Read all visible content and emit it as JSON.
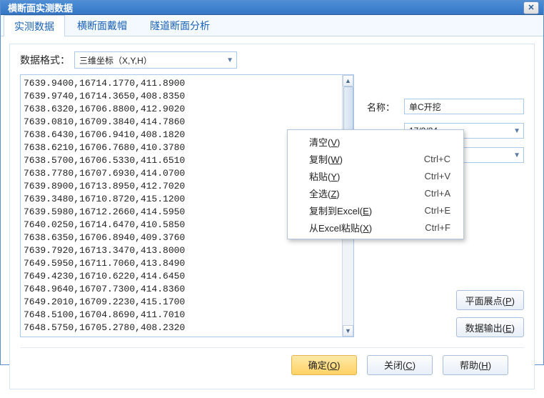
{
  "title": "横断面实测数据",
  "tabs": [
    {
      "label": "实测数据",
      "active": true
    },
    {
      "label": "横断面戴帽",
      "active": false
    },
    {
      "label": "隧道断面分析",
      "active": false
    }
  ],
  "format": {
    "label": "数据格式：",
    "value": "三维坐标（X,Y,H）"
  },
  "data_lines": [
    "7639.9400,16714.1770,411.8900",
    "7639.9740,16714.3650,408.8350",
    "7638.6320,16706.8800,412.9020",
    "7639.0810,16709.3840,414.7860",
    "7638.6430,16706.9410,408.1820",
    "7638.6210,16706.7680,410.3780",
    "7638.5700,16706.5330,411.6510",
    "7638.7780,16707.6930,414.0700",
    "7639.8900,16713.8950,412.7020",
    "7639.3480,16710.8720,415.1200",
    "7639.5980,16712.2660,414.5950",
    "7640.0250,16714.6470,410.5850",
    "7638.6350,16706.8940,409.3760",
    "7639.7920,16713.3470,413.8000",
    "7649.5950,16711.7060,413.8490",
    "7649.4230,16710.6220,414.6450",
    "7648.9640,16707.7300,414.8360",
    "7649.2010,16709.2230,415.1700",
    "7648.5100,16704.8690,411.7010",
    "7648.5750,16705.2780,408.2320"
  ],
  "side": {
    "name": {
      "label": "名称：",
      "value": "单C开挖"
    },
    "date": {
      "value": "17/2/24"
    },
    "color": {
      "value": "clBlack"
    }
  },
  "buttons": {
    "plane": "平面展点(P)",
    "export": "数据输出(E)",
    "ok": "确定(O)",
    "close": "关闭(C)",
    "help": "帮助(H)"
  },
  "context_menu": [
    {
      "label": "清空",
      "mnemonic": "V",
      "shortcut": ""
    },
    {
      "label": "复制",
      "mnemonic": "W",
      "shortcut": "Ctrl+C"
    },
    {
      "label": "粘贴",
      "mnemonic": "Y",
      "shortcut": "Ctrl+V"
    },
    {
      "label": "全选",
      "mnemonic": "Z",
      "shortcut": "Ctrl+A"
    },
    {
      "label": "复制到Excel",
      "mnemonic": "E",
      "shortcut": "Ctrl+E"
    },
    {
      "label": "从Excel粘贴",
      "mnemonic": "X",
      "shortcut": "Ctrl+F"
    }
  ]
}
